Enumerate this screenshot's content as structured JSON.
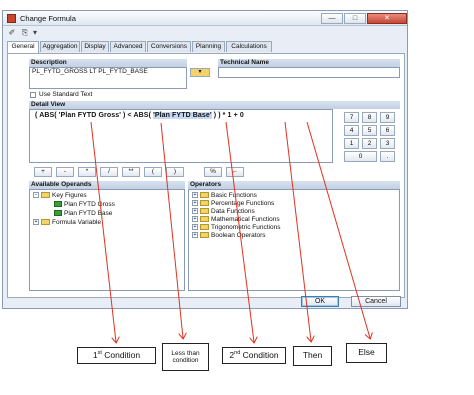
{
  "window": {
    "title": "Change Formula",
    "min_glyph": "—",
    "max_glyph": "□",
    "close_glyph": "✕"
  },
  "toolbar": {
    "icon1": "✐",
    "icon2": "⎘",
    "icon3": "▾"
  },
  "tabs": [
    "General",
    "Aggregation",
    "Display",
    "Advanced",
    "Conversions",
    "Planning",
    "Calculations"
  ],
  "description": {
    "label": "Description",
    "value": "PL_FYTD_GROSS LT PL_FYTD_BASE",
    "tech_label": "Technical Name",
    "tech_value": "",
    "use_standard_text": "Use Standard Text"
  },
  "detail_view": {
    "label": "Detail View",
    "formula_prefix": "( ABS( ",
    "formula_gross": "'Plan FYTD Gross'",
    "formula_middle": " ) < ABS( ",
    "formula_base": "'Plan FYTD Base'",
    "formula_suffix": " ) ) * 1 + 0"
  },
  "keypad": [
    "7",
    "8",
    "9",
    "4",
    "5",
    "6",
    "1",
    "2",
    "3",
    "0",
    "."
  ],
  "operator_buttons": [
    "+",
    "-",
    "*",
    "/",
    "**",
    "(",
    ")",
    "%",
    "←"
  ],
  "available_operands": {
    "label": "Available Operands",
    "key_figures": "Key Figures",
    "items": [
      "Plan FYTD Gross",
      "Plan FYTD Base"
    ],
    "formula_variable": "Formula Variable"
  },
  "operators": {
    "label": "Operators",
    "items": [
      "Basic Functions",
      "Percentage Functions",
      "Data Functions",
      "Mathematical Functions",
      "Trigonometric Functions",
      "Boolean Operators"
    ]
  },
  "buttons": {
    "ok": "OK",
    "cancel": "Cancel"
  },
  "annotations": {
    "first_condition_num": "1",
    "first_condition_sup": "st",
    "first_condition_text": " Condition",
    "less_than": "Less than condition",
    "second_condition_num": "2",
    "second_condition_sup": "nd",
    "second_condition_text": " Condition",
    "then": "Then",
    "else": "Else"
  },
  "colors": {
    "arrow": "#e0321f",
    "accent": "#3c7fb1"
  }
}
